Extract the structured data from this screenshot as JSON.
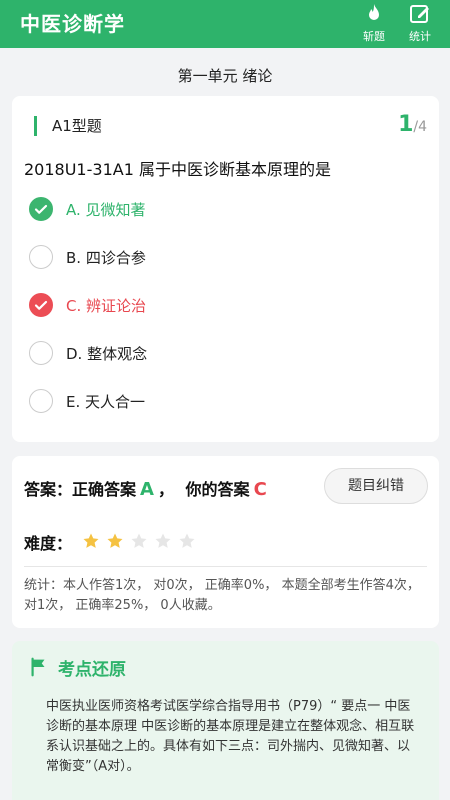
{
  "app": {
    "title": "中医诊断学",
    "actions": [
      {
        "label": "斩题",
        "icon": "flame-icon"
      },
      {
        "label": "统计",
        "icon": "edit-icon"
      }
    ]
  },
  "unit_title": "第一单元 绪论",
  "question": {
    "type": "A1型题",
    "current": "1",
    "total": "/4",
    "text": "2018U1-31A1 属于中医诊断基本原理的是",
    "options": [
      {
        "label": "A. 见微知著",
        "state": "correct"
      },
      {
        "label": "B. 四诊合参",
        "state": "none"
      },
      {
        "label": "C. 辨证论治",
        "state": "wrong"
      },
      {
        "label": "D. 整体观念",
        "state": "none"
      },
      {
        "label": "E. 天人合一",
        "state": "none"
      }
    ]
  },
  "answer": {
    "prefix": "答案：正确答案",
    "correct": "A",
    "sep": "，",
    "yours_label": "你的答案",
    "yours": "C",
    "correction_button": "题目纠错",
    "difficulty_label": "难度：",
    "difficulty_stars": 2,
    "difficulty_max": 5,
    "stats": "统计：本人作答1次， 对0次， 正确率0%， 本题全部考生作答4次， 对1次， 正确率25%， 0人收藏。"
  },
  "knowledge": {
    "title": "考点还原",
    "text": "中医执业医师资格考试医学综合指导用书（P79）“ 要点一 中医诊断的基本原理 中医诊断的基本原理是建立在整体观念、相互联系认识基础之上的。具体有如下三点：司外揣内、见微知著、以常衡变”（A对）。"
  },
  "colors": {
    "primary": "#2eb36b",
    "wrong": "#e8474f",
    "star": "#f5c242",
    "star_empty": "#e6e6e6"
  }
}
